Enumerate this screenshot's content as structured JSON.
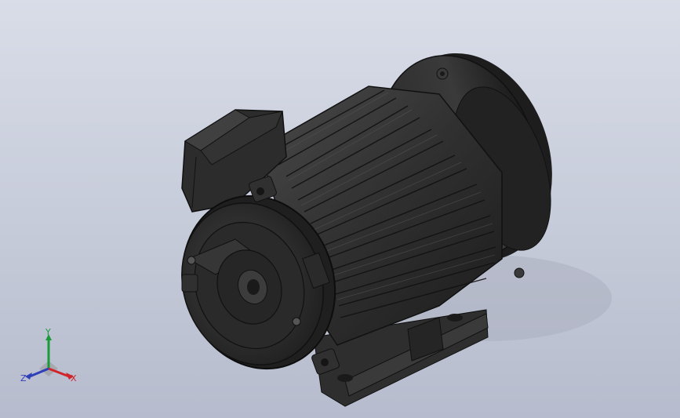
{
  "viewport": {
    "background_top": "#d9dde8",
    "background_bottom": "#b6bccd",
    "model_color": "#2b2b2b"
  },
  "triad": {
    "x_label": "X",
    "y_label": "Y",
    "z_label": "Z",
    "x_color": "#d0262b",
    "y_color": "#1c9a3a",
    "z_color": "#2f3fb8"
  }
}
